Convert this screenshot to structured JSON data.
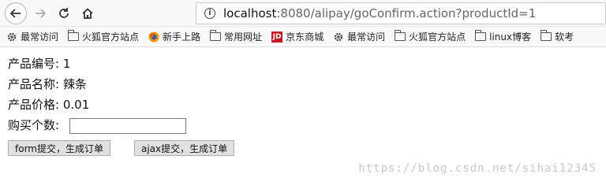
{
  "urlbar": {
    "host": "localhost",
    "rest": ":8080/alipay/goConfirm.action?productId=1"
  },
  "bookmarks": [
    {
      "icon": "gear-icon",
      "label": "最常访问"
    },
    {
      "icon": "folder-icon",
      "label": "火狐官方站点"
    },
    {
      "icon": "firefox-icon",
      "label": "新手上路"
    },
    {
      "icon": "folder-icon",
      "label": "常用网址"
    },
    {
      "icon": "jd-icon",
      "label": "京东商城"
    },
    {
      "icon": "gear-icon",
      "label": "最常访问"
    },
    {
      "icon": "folder-icon",
      "label": "火狐官方站点"
    },
    {
      "icon": "folder-icon",
      "label": "linux博客"
    },
    {
      "icon": "folder-icon",
      "label": "软考"
    }
  ],
  "jd_icon_text": "JD",
  "product": {
    "id_label": "产品编号:",
    "id_value": "1",
    "name_label": "产品名称:",
    "name_value": "辣条",
    "price_label": "产品价格:",
    "price_value": "0.01",
    "qty_label": "购买个数:"
  },
  "buttons": {
    "form_submit": "form提交，生成订单",
    "ajax_submit": "ajax提交，生成订单"
  },
  "watermark": "https://blog.csdn.net/sihai12345"
}
